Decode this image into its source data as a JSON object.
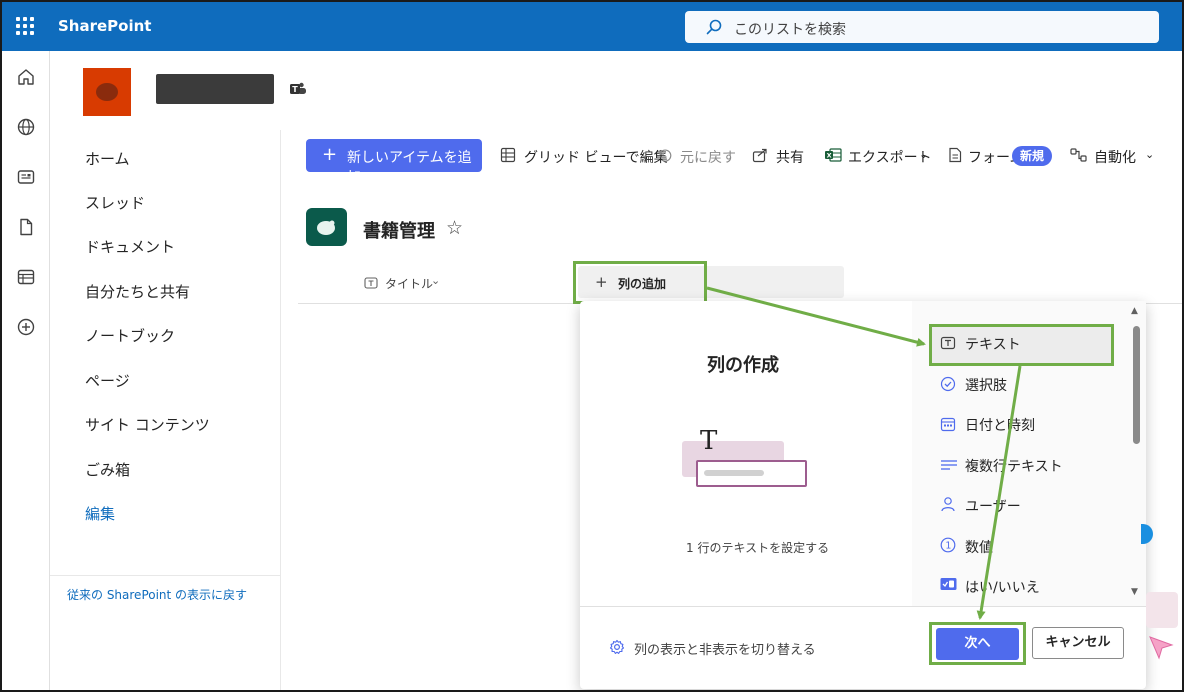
{
  "app": {
    "brand": "SharePoint",
    "search_placeholder": "このリストを検索"
  },
  "leftnav": {
    "items": [
      "ホーム",
      "スレッド",
      "ドキュメント",
      "自分たちと共有",
      "ノートブック",
      "ページ",
      "サイト コンテンツ",
      "ごみ箱"
    ],
    "edit": "編集",
    "back_link": "従来の SharePoint の表示に戻す"
  },
  "commandbar": {
    "new_item": "新しいアイテムを追加",
    "grid_edit": "グリッド ビューで編集",
    "undo": "元に戻す",
    "share": "共有",
    "export": "エクスポート",
    "forms": "フォーム",
    "forms_badge": "新規",
    "automate": "自動化"
  },
  "list": {
    "title": "書籍管理",
    "title_column": "タイトル",
    "add_column": "列の追加"
  },
  "dialog": {
    "title": "列の作成",
    "description": "1 行のテキストを設定する",
    "types": [
      "テキスト",
      "選択肢",
      "日付と時刻",
      "複数行テキスト",
      "ユーザー",
      "数値",
      "はい/いいえ"
    ],
    "selected_type": "テキスト",
    "toggle_columns": "列の表示と非表示を切り替える",
    "next": "次へ",
    "cancel": "キャンセル"
  },
  "colors": {
    "suite_bar": "#0f6cbd",
    "accent": "#4f6bed",
    "highlight": "#70ad47",
    "site_logo": "#d83b01",
    "list_icon": "#0b5a4b"
  }
}
